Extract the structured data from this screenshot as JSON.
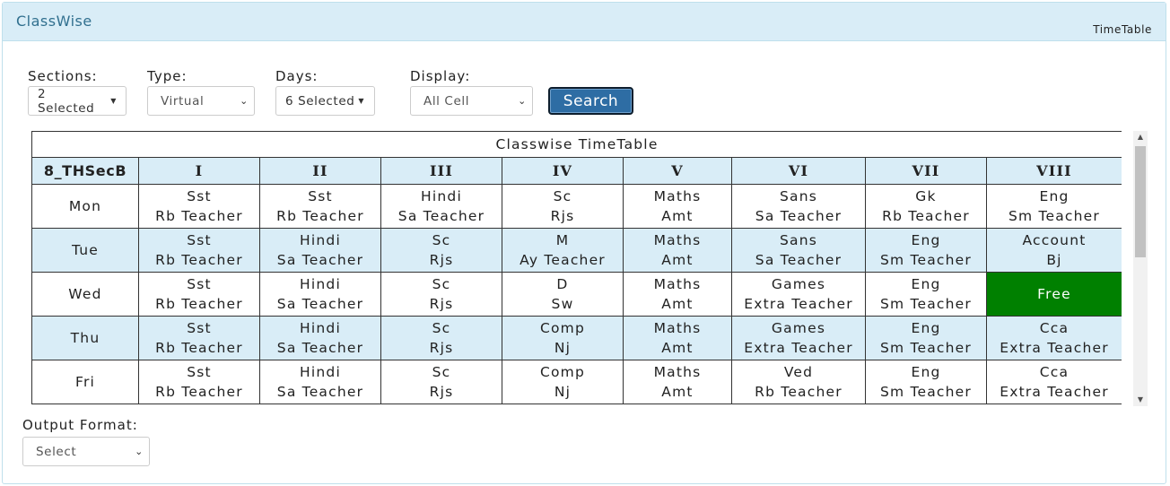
{
  "header": {
    "title": "ClassWise",
    "subtitle": "TimeTable"
  },
  "filters": {
    "sections": {
      "label": "Sections:",
      "value": "2 Selected"
    },
    "type": {
      "label": "Type:",
      "value": "Virtual"
    },
    "days": {
      "label": "Days:",
      "value": "6 Selected"
    },
    "display": {
      "label": "Display:",
      "value": "All Cell"
    },
    "search_label": "Search"
  },
  "timetable": {
    "caption": "Classwise TimeTable",
    "section_name": "8_THSecB",
    "periods": [
      "I",
      "II",
      "III",
      "IV",
      "V",
      "VI",
      "VII",
      "VIII"
    ],
    "rows": [
      {
        "day": "Mon",
        "cells": [
          {
            "subject": "Sst",
            "teacher": "Rb Teacher"
          },
          {
            "subject": "Sst",
            "teacher": "Rb Teacher"
          },
          {
            "subject": "Hindi",
            "teacher": "Sa Teacher"
          },
          {
            "subject": "Sc",
            "teacher": "Rjs"
          },
          {
            "subject": "Maths",
            "teacher": "Amt"
          },
          {
            "subject": "Sans",
            "teacher": "Sa Teacher"
          },
          {
            "subject": "Gk",
            "teacher": "Rb Teacher"
          },
          {
            "subject": "Eng",
            "teacher": "Sm Teacher"
          }
        ]
      },
      {
        "day": "Tue",
        "cells": [
          {
            "subject": "Sst",
            "teacher": "Rb Teacher"
          },
          {
            "subject": "Hindi",
            "teacher": "Sa Teacher"
          },
          {
            "subject": "Sc",
            "teacher": "Rjs"
          },
          {
            "subject": "M",
            "teacher": "Ay Teacher"
          },
          {
            "subject": "Maths",
            "teacher": "Amt"
          },
          {
            "subject": "Sans",
            "teacher": "Sa Teacher"
          },
          {
            "subject": "Eng",
            "teacher": "Sm Teacher"
          },
          {
            "subject": "Account",
            "teacher": "Bj"
          }
        ]
      },
      {
        "day": "Wed",
        "cells": [
          {
            "subject": "Sst",
            "teacher": "Rb Teacher"
          },
          {
            "subject": "Hindi",
            "teacher": "Sa Teacher"
          },
          {
            "subject": "Sc",
            "teacher": "Rjs"
          },
          {
            "subject": "D",
            "teacher": "Sw"
          },
          {
            "subject": "Maths",
            "teacher": "Amt"
          },
          {
            "subject": "Games",
            "teacher": "Extra Teacher"
          },
          {
            "subject": "Eng",
            "teacher": "Sm Teacher"
          },
          {
            "free": "Free"
          }
        ]
      },
      {
        "day": "Thu",
        "cells": [
          {
            "subject": "Sst",
            "teacher": "Rb Teacher"
          },
          {
            "subject": "Hindi",
            "teacher": "Sa Teacher"
          },
          {
            "subject": "Sc",
            "teacher": "Rjs"
          },
          {
            "subject": "Comp",
            "teacher": "Nj"
          },
          {
            "subject": "Maths",
            "teacher": "Amt"
          },
          {
            "subject": "Games",
            "teacher": "Extra Teacher"
          },
          {
            "subject": "Eng",
            "teacher": "Sm Teacher"
          },
          {
            "subject": "Cca",
            "teacher": "Extra Teacher"
          }
        ]
      },
      {
        "day": "Fri",
        "cells": [
          {
            "subject": "Sst",
            "teacher": "Rb Teacher"
          },
          {
            "subject": "Hindi",
            "teacher": "Sa Teacher"
          },
          {
            "subject": "Sc",
            "teacher": "Rjs"
          },
          {
            "subject": "Comp",
            "teacher": "Nj"
          },
          {
            "subject": "Maths",
            "teacher": "Amt"
          },
          {
            "subject": "Ved",
            "teacher": "Rb Teacher"
          },
          {
            "subject": "Eng",
            "teacher": "Sm Teacher"
          },
          {
            "subject": "Cca",
            "teacher": "Extra Teacher"
          }
        ]
      }
    ]
  },
  "output": {
    "label": "Output Format:",
    "value": "Select"
  },
  "colors": {
    "header_bg": "#d9edf7",
    "free": "#008000",
    "search_btn": "#2e6da4"
  }
}
